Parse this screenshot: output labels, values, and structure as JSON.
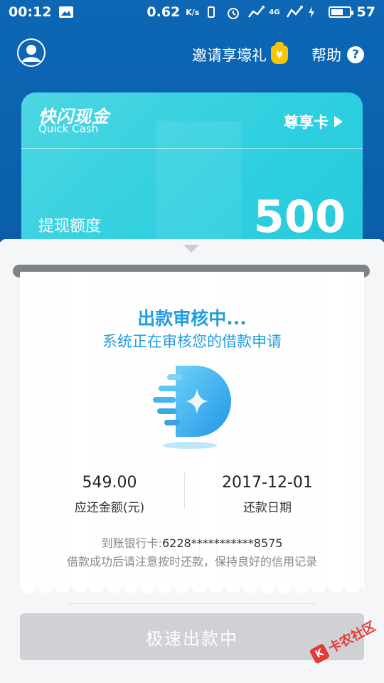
{
  "status_bar": {
    "time": "00:12",
    "speed": "0.62",
    "speed_unit": "K/s",
    "network": "4G",
    "battery_level": "57"
  },
  "header": {
    "invite_label": "邀请享壕礼",
    "gift_symbol": "¥",
    "help_label": "帮助",
    "help_symbol": "?"
  },
  "card": {
    "brand_cn": "快闪现金",
    "brand_en": "Quick Cash",
    "tier_label": "尊享卡",
    "quota_label": "提现额度",
    "quota_value": "500"
  },
  "status": {
    "title": "出款审核中...",
    "subtitle": "系统正在审核您的借款申请"
  },
  "repayment": {
    "amount_value": "549.00",
    "amount_label": "应还金额(元)",
    "date_value": "2017-12-01",
    "date_label": "还款日期"
  },
  "bank": {
    "label": "到账银行卡:",
    "card_number": "6228***********8575"
  },
  "notice": "借款成功后请注意按时还款，保持良好的信用记录",
  "action_button": "极速出款中",
  "watermark": {
    "text": "卡农社区",
    "mark": "K"
  },
  "colors": {
    "header_blue": "#0d67b5",
    "card_cyan": "#2ecfe0",
    "accent_blue": "#1f9de0",
    "button_disabled": "#cfd1d4",
    "gift_yellow": "#f6c400",
    "watermark_red": "#e23a35"
  }
}
